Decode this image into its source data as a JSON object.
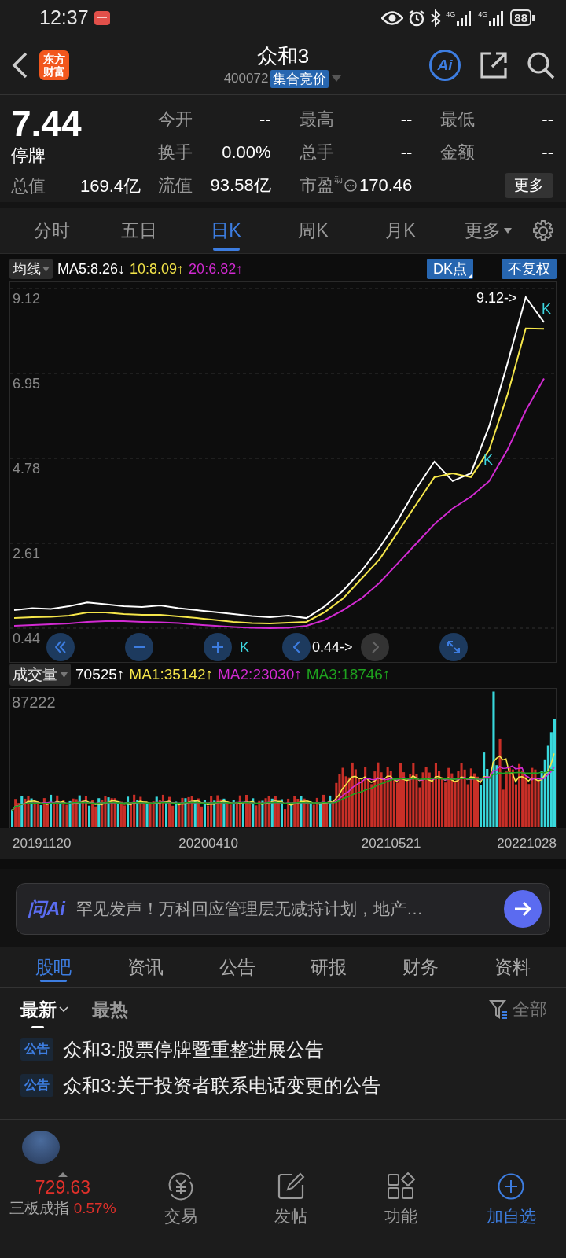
{
  "status_bar": {
    "time": "12:37",
    "networks": [
      "4G",
      "4G"
    ],
    "battery": "88"
  },
  "header": {
    "logo_lines": [
      "东方",
      "财富"
    ],
    "title": "众和3",
    "code": "400072",
    "badge": "集合竞价",
    "ai_label": "Ai"
  },
  "quote": {
    "price": "7.44",
    "state": "停牌",
    "stats": [
      {
        "label": "今开",
        "value": "--"
      },
      {
        "label": "最高",
        "value": "--"
      },
      {
        "label": "最低",
        "value": "--"
      },
      {
        "label": "换手",
        "value": "0.00%"
      },
      {
        "label": "总手",
        "value": "--"
      },
      {
        "label": "金额",
        "value": "--"
      },
      {
        "label": "总值",
        "value": "169.4亿"
      },
      {
        "label": "流值",
        "value": "93.58亿"
      },
      {
        "label": "市盈",
        "sup": "动",
        "value": "170.46"
      }
    ],
    "more_button": "更多"
  },
  "chart_tabs": [
    {
      "label": "分时",
      "selected": false
    },
    {
      "label": "五日",
      "selected": false
    },
    {
      "label": "日K",
      "selected": true
    },
    {
      "label": "周K",
      "selected": false
    },
    {
      "label": "月K",
      "selected": false
    },
    {
      "label": "更多",
      "selected": false,
      "kind": "menu"
    }
  ],
  "price_chart": {
    "indicator": "均线",
    "dk_button": "DK点",
    "adjust_button": "不复权",
    "high_label": "9.12->",
    "low_label": "0.44->",
    "markers": [
      "K",
      "K",
      "K"
    ],
    "controls": [
      {
        "kind": "rewind",
        "disabled": false
      },
      {
        "kind": "zoom_out",
        "disabled": false
      },
      {
        "kind": "zoom_in",
        "disabled": false
      },
      {
        "kind": "back",
        "disabled": false
      },
      {
        "kind": "forward",
        "disabled": true
      },
      {
        "kind": "expand",
        "disabled": false
      }
    ],
    "chart_data": {
      "type": "line",
      "grid": true,
      "ylim": [
        0.44,
        9.12
      ],
      "yticks": [
        0.44,
        2.61,
        4.78,
        6.95,
        9.12
      ],
      "series": [
        {
          "name": "MA5:8.26↓",
          "color": "#ffffff",
          "values": [
            0.9,
            0.95,
            0.93,
            1.0,
            1.1,
            1.05,
            1.0,
            0.98,
            1.02,
            0.95,
            0.9,
            0.85,
            0.8,
            0.75,
            0.72,
            0.76,
            0.7,
            1.0,
            1.4,
            1.9,
            2.5,
            3.2,
            4.0,
            4.7,
            4.2,
            4.4,
            5.6,
            7.2,
            8.9,
            8.26
          ]
        },
        {
          "name": "10:8.09↑",
          "color": "#f5e64a",
          "values": [
            0.7,
            0.72,
            0.73,
            0.76,
            0.84,
            0.84,
            0.8,
            0.78,
            0.78,
            0.74,
            0.7,
            0.65,
            0.6,
            0.57,
            0.56,
            0.58,
            0.6,
            0.85,
            1.2,
            1.7,
            2.2,
            2.9,
            3.6,
            4.3,
            4.4,
            4.3,
            5.0,
            6.4,
            8.1,
            8.09
          ]
        },
        {
          "name": "20:6.82↑",
          "color": "#d22ad2",
          "values": [
            0.5,
            0.52,
            0.54,
            0.56,
            0.6,
            0.62,
            0.62,
            0.6,
            0.59,
            0.57,
            0.53,
            0.5,
            0.47,
            0.45,
            0.44,
            0.45,
            0.5,
            0.65,
            0.9,
            1.2,
            1.6,
            2.1,
            2.6,
            3.1,
            3.5,
            3.8,
            4.2,
            5.0,
            6.0,
            6.82
          ]
        }
      ]
    }
  },
  "volume_chart": {
    "indicator": "成交量",
    "legend": [
      {
        "text": "70525↑",
        "color": "#ffffff"
      },
      {
        "text": "MA1:35142↑",
        "color": "#f5e64a"
      },
      {
        "text": "MA2:23030↑",
        "color": "#d22ad2"
      },
      {
        "text": "MA3:18746↑",
        "color": "#1fa31f"
      }
    ],
    "max_label": "87222",
    "dates": [
      "20191120",
      "20200410",
      "20210521",
      "20221028"
    ]
  },
  "ai_bar": {
    "logo": "问Ai",
    "message": "罕见发声！万科回应管理层无减持计划，地产…"
  },
  "section_tabs": [
    {
      "label": "股吧",
      "selected": true
    },
    {
      "label": "资讯",
      "selected": false
    },
    {
      "label": "公告",
      "selected": false
    },
    {
      "label": "研报",
      "selected": false
    },
    {
      "label": "财务",
      "selected": false
    },
    {
      "label": "资料",
      "selected": false
    }
  ],
  "sort_tabs": [
    {
      "label": "最新",
      "selected": true
    },
    {
      "label": "最热",
      "selected": false
    }
  ],
  "filter": "全部",
  "news": [
    {
      "tag": "公告",
      "title": "众和3:股票停牌暨重整进展公告"
    },
    {
      "tag": "公告",
      "title": "众和3:关于投资者联系电话变更的公告"
    }
  ],
  "bottom_nav": {
    "index_value": "729.63",
    "index_name": "三板成指",
    "index_change": "0.57%",
    "items": [
      {
        "kind": "trade",
        "label": "交易",
        "selected": false
      },
      {
        "kind": "post",
        "label": "发帖",
        "selected": false
      },
      {
        "kind": "functions",
        "label": "功能",
        "selected": false
      },
      {
        "kind": "add",
        "label": "加自选",
        "selected": true
      }
    ]
  }
}
